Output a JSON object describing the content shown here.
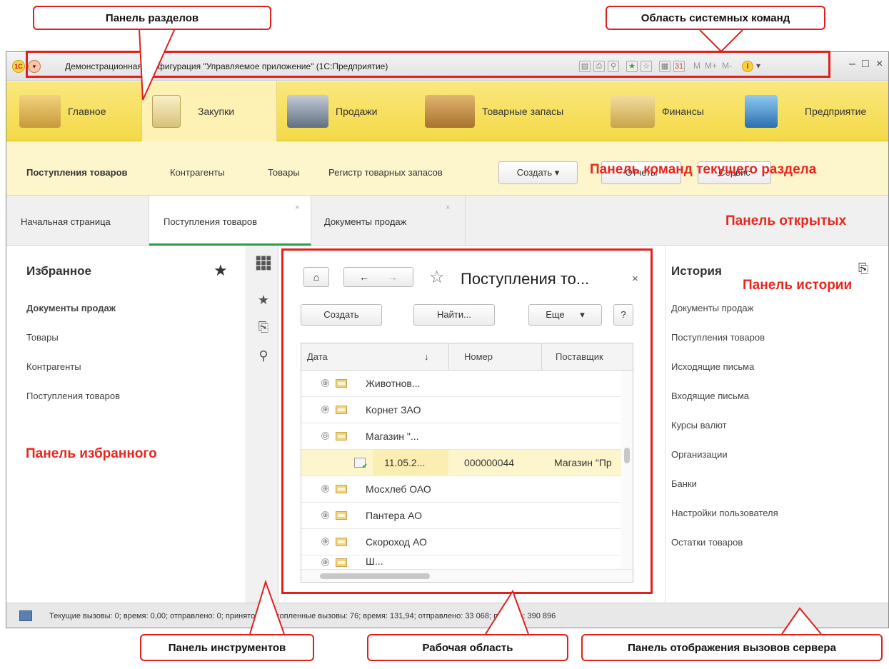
{
  "callouts": {
    "sections_panel": "Панель разделов",
    "system_commands": "Область системных команд",
    "current_section_commands": "Панель команд текущего раздела",
    "open_panel": "Панель открытых",
    "history_panel": "Панель истории",
    "favorites_panel": "Панель избранного",
    "tools_panel": "Панель инструментов",
    "work_area": "Рабочая область",
    "server_calls_panel": "Панель отображения вызовов сервера"
  },
  "window": {
    "title": "Демонстрационная конфигурация \"Управляемое приложение\" (1С:Предприятие)",
    "logo": "1С",
    "sys_m": "M",
    "sys_mplus": "M+",
    "sys_mminus": "M-",
    "minimize": "–",
    "maximize": "□",
    "close": "×"
  },
  "sections": [
    {
      "label": "Главное",
      "icon": "lamp-icon",
      "color": "#c79a3a"
    },
    {
      "label": "Закупки",
      "icon": "shopping-bag-icon",
      "color": "#d8c27a"
    },
    {
      "label": "Продажи",
      "icon": "cash-register-icon",
      "color": "#607080"
    },
    {
      "label": "Товарные запасы",
      "icon": "box-icon",
      "color": "#b9863e"
    },
    {
      "label": "Финансы",
      "icon": "coins-icon",
      "color": "#c9a44a"
    },
    {
      "label": "Предприятие",
      "icon": "building-icon",
      "color": "#3a86c8"
    }
  ],
  "commands": {
    "items": [
      "Поступления товаров",
      "Контрагенты",
      "Товары",
      "Регистр товарных запасов"
    ],
    "create": "Создать",
    "create_arrow": "▾",
    "reports": "Отчеты",
    "service": "Сервис"
  },
  "tabs": [
    {
      "label": "Начальная страница",
      "closable": false
    },
    {
      "label": "Поступления товаров",
      "closable": true
    },
    {
      "label": "Документы продаж",
      "closable": true
    }
  ],
  "tab_close": "×",
  "favorites": {
    "title": "Избранное",
    "star": "★",
    "items": [
      "Документы продаж",
      "Товары",
      "Контрагенты",
      "Поступления товаров"
    ]
  },
  "tools": {
    "grid": "⋮⋮⋮",
    "star": "★",
    "history": "⎘",
    "search": "⚲"
  },
  "form": {
    "home": "⌂",
    "back": "←",
    "forward": "→",
    "star": "☆",
    "title": "Поступления то...",
    "close": "×",
    "create": "Создать",
    "find": "Найти...",
    "more": "Еще",
    "more_arrow": "▾",
    "help": "?",
    "columns": [
      "Дата",
      "Номер",
      "Поставщик"
    ],
    "sort_arrow": "↓",
    "rows": [
      {
        "expand": "⊕",
        "name": "Животнов..."
      },
      {
        "expand": "⊕",
        "name": "Корнет ЗАО"
      },
      {
        "expand": "⊖",
        "name": "Магазин \"..."
      },
      {
        "date": "11.05.2...",
        "number": "000000044",
        "supplier": "Магазин \"Пр"
      },
      {
        "expand": "⊕",
        "name": "Мосхлеб ОАО"
      },
      {
        "expand": "⊕",
        "name": "Пантера АО"
      },
      {
        "expand": "⊕",
        "name": "Скороход АО"
      },
      {
        "expand": "⊕",
        "name": "Ш..."
      }
    ]
  },
  "history": {
    "title": "История",
    "icon": "⎘",
    "items": [
      "Документы продаж",
      "Поступления товаров",
      "Исходящие письма",
      "Входящие письма",
      "Курсы валют",
      "Организации",
      "Банки",
      "Настройки пользователя",
      "Остатки товаров"
    ]
  },
  "status": {
    "text": "Текущие вызовы: 0; время: 0,00; отправлено: 0; принято: 0   Накопленные вызовы: 76; время: 131,94; отправлено: 33 068; принято: 390 896"
  }
}
